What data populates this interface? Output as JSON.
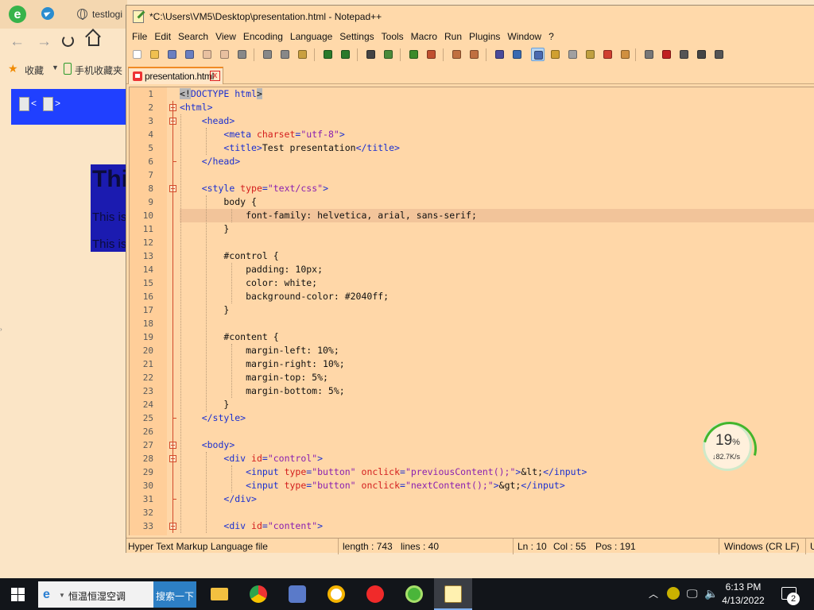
{
  "browser": {
    "tab_title": "testlogi",
    "bookmarks": {
      "label": "收藏",
      "mobile_label": "手机收藏夹"
    },
    "page": {
      "control_prev": "<",
      "control_next": ">",
      "heading_fragment": "Thi",
      "para1_fragment": "This is",
      "para2_fragment": "This is"
    },
    "colors": {
      "control_bg": "#2040ff"
    }
  },
  "notepad": {
    "title": "*C:\\Users\\VM5\\Desktop\\presentation.html - Notepad++",
    "menu": [
      "File",
      "Edit",
      "Search",
      "View",
      "Encoding",
      "Language",
      "Settings",
      "Tools",
      "Macro",
      "Run",
      "Plugins",
      "Window",
      "?"
    ],
    "file_tab": {
      "label": "presentation.html",
      "close": "x"
    },
    "current_line": 10,
    "lines": [
      "1",
      "2",
      "3",
      "4",
      "5",
      "6",
      "7",
      "8",
      "9",
      "10",
      "11",
      "12",
      "13",
      "14",
      "15",
      "16",
      "17",
      "18",
      "19",
      "20",
      "21",
      "22",
      "23",
      "24",
      "25",
      "26",
      "27",
      "28",
      "29",
      "30",
      "31",
      "32",
      "33"
    ],
    "code": [
      [
        {
          "c": "t-dt",
          "t": "<!"
        },
        {
          "c": "t-tag",
          "t": "DOCTYPE html"
        },
        {
          "c": "t-dt",
          "t": ">"
        }
      ],
      [
        {
          "c": "t-tag",
          "t": "<html>"
        }
      ],
      [
        {
          "c": "t-txt",
          "t": "    "
        },
        {
          "c": "t-tag",
          "t": "<head>"
        }
      ],
      [
        {
          "c": "t-txt",
          "t": "        "
        },
        {
          "c": "t-tag",
          "t": "<meta "
        },
        {
          "c": "t-attr",
          "t": "charset"
        },
        {
          "c": "t-tag",
          "t": "="
        },
        {
          "c": "t-val",
          "t": "\"utf-8\""
        },
        {
          "c": "t-tag",
          "t": ">"
        }
      ],
      [
        {
          "c": "t-txt",
          "t": "        "
        },
        {
          "c": "t-tag",
          "t": "<title>"
        },
        {
          "c": "t-txt",
          "t": "Test presentation"
        },
        {
          "c": "t-tag",
          "t": "</title>"
        }
      ],
      [
        {
          "c": "t-txt",
          "t": "    "
        },
        {
          "c": "t-tag",
          "t": "</head>"
        }
      ],
      [
        {
          "c": "t-txt",
          "t": ""
        }
      ],
      [
        {
          "c": "t-txt",
          "t": "    "
        },
        {
          "c": "t-tag",
          "t": "<style "
        },
        {
          "c": "t-attr",
          "t": "type"
        },
        {
          "c": "t-tag",
          "t": "="
        },
        {
          "c": "t-val",
          "t": "\"text/css\""
        },
        {
          "c": "t-tag",
          "t": ">"
        }
      ],
      [
        {
          "c": "t-sel",
          "t": "        body {"
        }
      ],
      [
        {
          "c": "t-prop",
          "t": "            font-family: helvetica, arial, sans-serif;"
        }
      ],
      [
        {
          "c": "t-sel",
          "t": "        }"
        }
      ],
      [
        {
          "c": "t-txt",
          "t": ""
        }
      ],
      [
        {
          "c": "t-sel",
          "t": "        #control {"
        }
      ],
      [
        {
          "c": "t-prop",
          "t": "            padding: 10px;"
        }
      ],
      [
        {
          "c": "t-prop",
          "t": "            color: white;"
        }
      ],
      [
        {
          "c": "t-prop",
          "t": "            background-color: #2040ff;"
        }
      ],
      [
        {
          "c": "t-sel",
          "t": "        }"
        }
      ],
      [
        {
          "c": "t-txt",
          "t": ""
        }
      ],
      [
        {
          "c": "t-sel",
          "t": "        #content {"
        }
      ],
      [
        {
          "c": "t-prop",
          "t": "            margin-left: 10%;"
        }
      ],
      [
        {
          "c": "t-prop",
          "t": "            margin-right: 10%;"
        }
      ],
      [
        {
          "c": "t-prop",
          "t": "            margin-top: 5%;"
        }
      ],
      [
        {
          "c": "t-prop",
          "t": "            margin-bottom: 5%;"
        }
      ],
      [
        {
          "c": "t-sel",
          "t": "        }"
        }
      ],
      [
        {
          "c": "t-txt",
          "t": "    "
        },
        {
          "c": "t-tag",
          "t": "</style>"
        }
      ],
      [
        {
          "c": "t-txt",
          "t": ""
        }
      ],
      [
        {
          "c": "t-txt",
          "t": "    "
        },
        {
          "c": "t-tag",
          "t": "<body>"
        }
      ],
      [
        {
          "c": "t-txt",
          "t": "        "
        },
        {
          "c": "t-tag",
          "t": "<div "
        },
        {
          "c": "t-attr",
          "t": "id"
        },
        {
          "c": "t-tag",
          "t": "="
        },
        {
          "c": "t-val",
          "t": "\"control\""
        },
        {
          "c": "t-tag",
          "t": ">"
        }
      ],
      [
        {
          "c": "t-txt",
          "t": "            "
        },
        {
          "c": "t-tag",
          "t": "<input "
        },
        {
          "c": "t-attr",
          "t": "type"
        },
        {
          "c": "t-tag",
          "t": "="
        },
        {
          "c": "t-val",
          "t": "\"button\""
        },
        {
          "c": "t-tag",
          "t": " "
        },
        {
          "c": "t-attr",
          "t": "onclick"
        },
        {
          "c": "t-tag",
          "t": "="
        },
        {
          "c": "t-val",
          "t": "\"previousContent();\""
        },
        {
          "c": "t-tag",
          "t": ">"
        },
        {
          "c": "t-txt",
          "t": "&lt;"
        },
        {
          "c": "t-tag",
          "t": "</input>"
        }
      ],
      [
        {
          "c": "t-txt",
          "t": "            "
        },
        {
          "c": "t-tag",
          "t": "<input "
        },
        {
          "c": "t-attr",
          "t": "type"
        },
        {
          "c": "t-tag",
          "t": "="
        },
        {
          "c": "t-val",
          "t": "\"button\""
        },
        {
          "c": "t-tag",
          "t": " "
        },
        {
          "c": "t-attr",
          "t": "onclick"
        },
        {
          "c": "t-tag",
          "t": "="
        },
        {
          "c": "t-val",
          "t": "\"nextContent();\""
        },
        {
          "c": "t-tag",
          "t": ">"
        },
        {
          "c": "t-txt",
          "t": "&gt;"
        },
        {
          "c": "t-tag",
          "t": "</input>"
        }
      ],
      [
        {
          "c": "t-txt",
          "t": "        "
        },
        {
          "c": "t-tag",
          "t": "</div>"
        }
      ],
      [
        {
          "c": "t-txt",
          "t": ""
        }
      ],
      [
        {
          "c": "t-txt",
          "t": "        "
        },
        {
          "c": "t-tag",
          "t": "<div "
        },
        {
          "c": "t-attr",
          "t": "id"
        },
        {
          "c": "t-tag",
          "t": "="
        },
        {
          "c": "t-val",
          "t": "\"content\""
        },
        {
          "c": "t-tag",
          "t": ">"
        }
      ]
    ],
    "status": {
      "filetype": "Hyper Text Markup Language file",
      "length": "length : 743",
      "lines": "lines : 40",
      "ln": "Ln : 10",
      "col": "Col : 55",
      "pos": "Pos : 191",
      "eol": "Windows (CR LF)",
      "enc_fragment": "U"
    }
  },
  "network_widget": {
    "percent": "19",
    "percent_sign": "%",
    "speed": "↓82.7K/s",
    "level": 0.19
  },
  "taskbar": {
    "search_text": "恒温恒湿空调",
    "search_button": "搜索一下",
    "apps": [
      "file-explorer-icon",
      "chrome-icon",
      "app-icon",
      "yandex-browser-icon",
      "yandex-icon",
      "360-browser-icon",
      "notepad-plus-plus-icon"
    ],
    "time": "6:13 PM",
    "date": "4/13/2022",
    "notification_count": "2"
  }
}
